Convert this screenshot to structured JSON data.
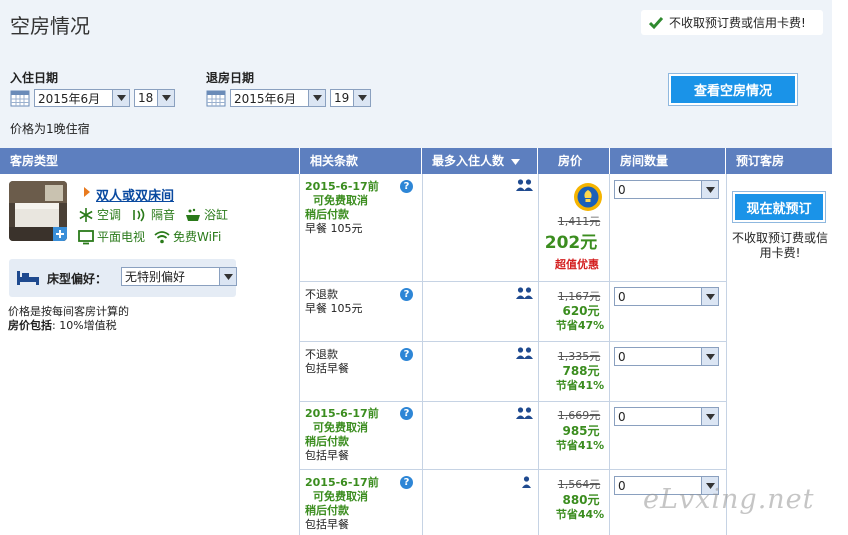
{
  "header": {
    "title": "空房情况",
    "notice": "不收取预订费或信用卡费!"
  },
  "dates": {
    "checkin_label": "入住日期",
    "checkin_month": "2015年6月",
    "checkin_day": "18",
    "checkout_label": "退房日期",
    "checkout_month": "2015年6月",
    "checkout_day": "19",
    "check_button": "查看空房情况",
    "price_note": "价格为1晚住宿"
  },
  "table": {
    "headers": [
      "客房类型",
      "相关条款",
      "最多入住人数",
      "房价",
      "房间数量",
      "预订客房"
    ]
  },
  "room": {
    "name": "双人或双床间",
    "amenities": [
      "空调",
      "隔音",
      "浴缸",
      "平面电视",
      "免费WiFi"
    ],
    "bed_pref_label": "床型偏好：",
    "bed_pref_value": "无特别偏好",
    "note_line1": "价格是按每间客房计算的",
    "note_line2_bold": "房价包括",
    "note_line2_rest": ": 10%增值税"
  },
  "rates": [
    {
      "terms_green": [
        "2015-6-17前",
        "可免费取消",
        "稍后付款"
      ],
      "terms": [
        "早餐 105元"
      ],
      "old_price": "1,411元",
      "new_price": "202元",
      "save": "超值优惠",
      "qty": "0"
    },
    {
      "terms_green": [],
      "terms": [
        "不退款",
        "早餐 105元"
      ],
      "old_price": "1,167元",
      "new_price": "620元",
      "save": "节省47%",
      "qty": "0"
    },
    {
      "terms_green": [],
      "terms": [
        "不退款",
        "包括早餐"
      ],
      "old_price": "1,335元",
      "new_price": "788元",
      "save": "节省41%",
      "qty": "0"
    },
    {
      "terms_green": [
        "2015-6-17前",
        "可免费取消",
        "稍后付款"
      ],
      "terms": [
        "包括早餐"
      ],
      "old_price": "1,669元",
      "new_price": "985元",
      "save": "节省41%",
      "qty": "0"
    },
    {
      "terms_green": [
        "2015-6-17前",
        "可免费取消",
        "稍后付款"
      ],
      "terms": [
        "包括早餐"
      ],
      "old_price": "1,564元",
      "new_price": "880元",
      "save": "节省44%",
      "qty": "0"
    }
  ],
  "booking": {
    "button": "现在就预订",
    "note": "不收取预订费或信用卡费!"
  },
  "watermark": "eLvxing.net",
  "colors": {
    "header_bar": "#5d7fbf",
    "accent_blue": "#1a93e8",
    "green": "#3b8d1f",
    "deal_red": "#d42020"
  }
}
